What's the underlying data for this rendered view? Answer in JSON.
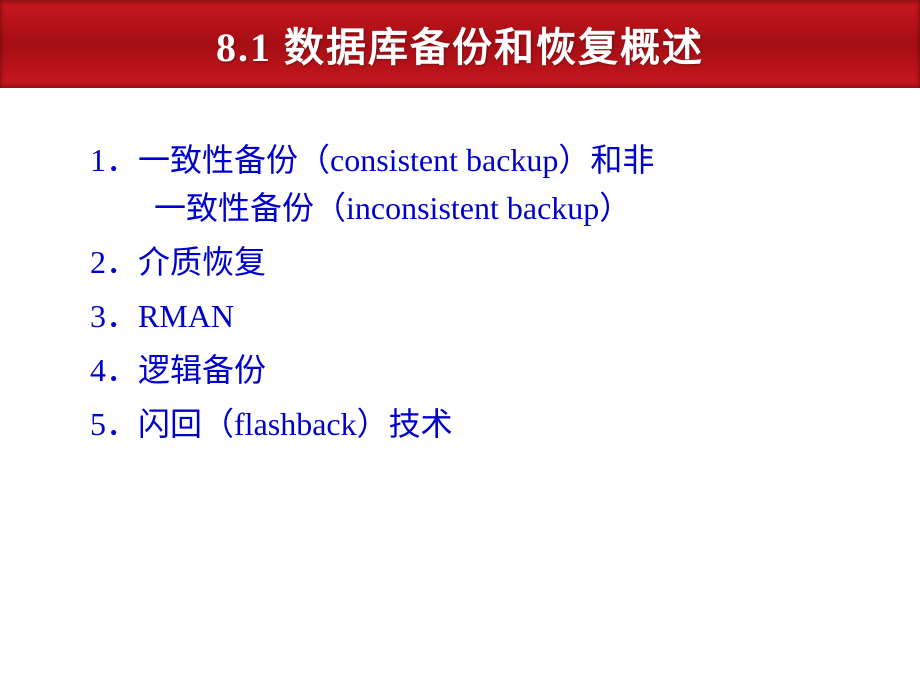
{
  "header": {
    "title": "8.1 数据库备份和恢复概述"
  },
  "content": {
    "items": [
      {
        "number": "1．",
        "text": "一致性备份（consistent backup）和非",
        "continuation": "一致性备份（inconsistent  backup）"
      },
      {
        "number": "2．",
        "text": "介质恢复",
        "continuation": ""
      },
      {
        "number": "3．",
        "text": "RMAN",
        "continuation": ""
      },
      {
        "number": "4．",
        "text": "逻辑备份",
        "continuation": ""
      },
      {
        "number": "5．",
        "text": "闪回（flashback）技术",
        "continuation": ""
      }
    ]
  }
}
